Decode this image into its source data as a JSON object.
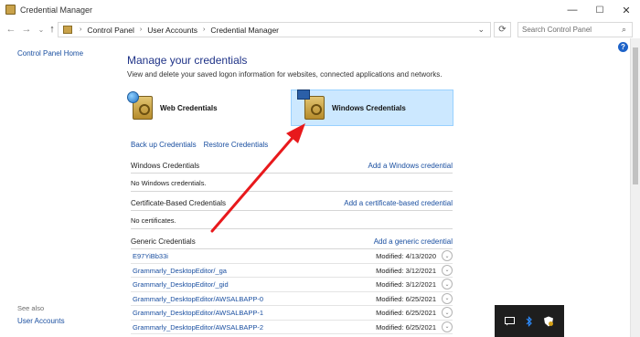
{
  "window": {
    "title": "Credential Manager"
  },
  "controls": {
    "minimize": "—",
    "maximize": "☐",
    "close": "✕"
  },
  "nav": {
    "back": "←",
    "forward": "→",
    "recent": "⌄",
    "up": "↑"
  },
  "address": {
    "breadcrumbs": [
      "Control Panel",
      "User Accounts",
      "Credential Manager"
    ],
    "separator": "›",
    "dropdown": "⌄",
    "refresh": "⟳"
  },
  "search": {
    "placeholder": "Search Control Panel",
    "icon": "⌕"
  },
  "left_pane": {
    "home_link": "Control Panel Home",
    "see_also": "See also",
    "see_also_link": "User Accounts"
  },
  "main": {
    "heading": "Manage your credentials",
    "description": "View and delete your saved logon information for websites, connected applications and networks.",
    "credential_types": [
      {
        "label": "Web Credentials",
        "selected": false
      },
      {
        "label": "Windows Credentials",
        "selected": true
      }
    ],
    "links": [
      "Back up Credentials",
      "Restore Credentials"
    ],
    "windows_section": {
      "title": "Windows Credentials",
      "add_link": "Add a Windows credential",
      "empty_text": "No Windows credentials."
    },
    "certificate_section": {
      "title": "Certificate-Based Credentials",
      "add_link": "Add a certificate-based credential",
      "empty_text": "No certificates."
    },
    "generic_section": {
      "title": "Generic Credentials",
      "add_link": "Add a generic credential",
      "expand_icon": "⌄",
      "items": [
        {
          "name": "E97YiBb33i",
          "modified": "Modified:  4/13/2020"
        },
        {
          "name": "Grammarly_DesktopEditor/_ga",
          "modified": "Modified:  3/12/2021"
        },
        {
          "name": "Grammarly_DesktopEditor/_gid",
          "modified": "Modified:  3/12/2021"
        },
        {
          "name": "Grammarly_DesktopEditor/AWSALBAPP-0",
          "modified": "Modified:  6/25/2021"
        },
        {
          "name": "Grammarly_DesktopEditor/AWSALBAPP-1",
          "modified": "Modified:  6/25/2021"
        },
        {
          "name": "Grammarly_DesktopEditor/AWSALBAPP-2",
          "modified": "Modified:  6/25/2021"
        }
      ]
    }
  },
  "help_icon": "?",
  "tray": {
    "icons": [
      "chat-icon",
      "bluetooth-icon",
      "security-shield-icon"
    ]
  },
  "annotation": {
    "color": "#e8191c"
  }
}
